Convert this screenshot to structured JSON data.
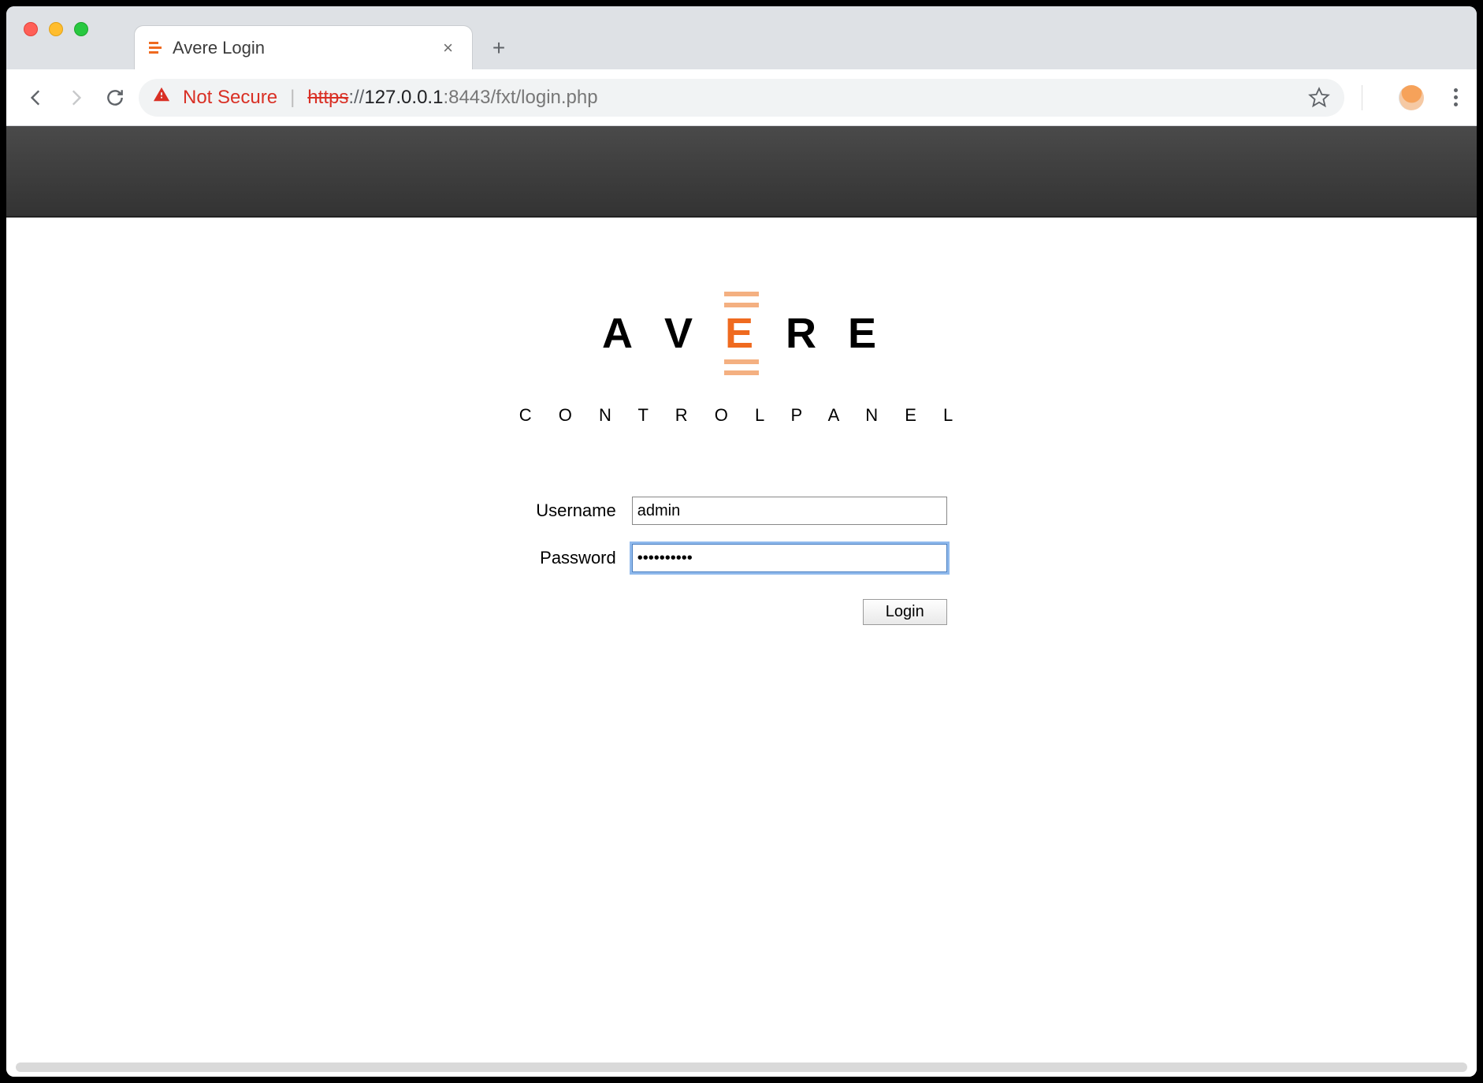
{
  "browser": {
    "tab_title": "Avere Login",
    "not_secure_label": "Not Secure",
    "url_scheme": "https",
    "url_sep": "://",
    "url_host": "127.0.0.1",
    "url_port_path": ":8443/fxt/login.php"
  },
  "brand": {
    "letters": {
      "a": "A",
      "v": "V",
      "e": "E",
      "r": "R",
      "e2": "E"
    },
    "subtitle": "C O N T R O L   P A N E L"
  },
  "form": {
    "username_label": "Username",
    "username_value": "admin",
    "password_label": "Password",
    "password_value": "••••••••••",
    "login_label": "Login"
  }
}
